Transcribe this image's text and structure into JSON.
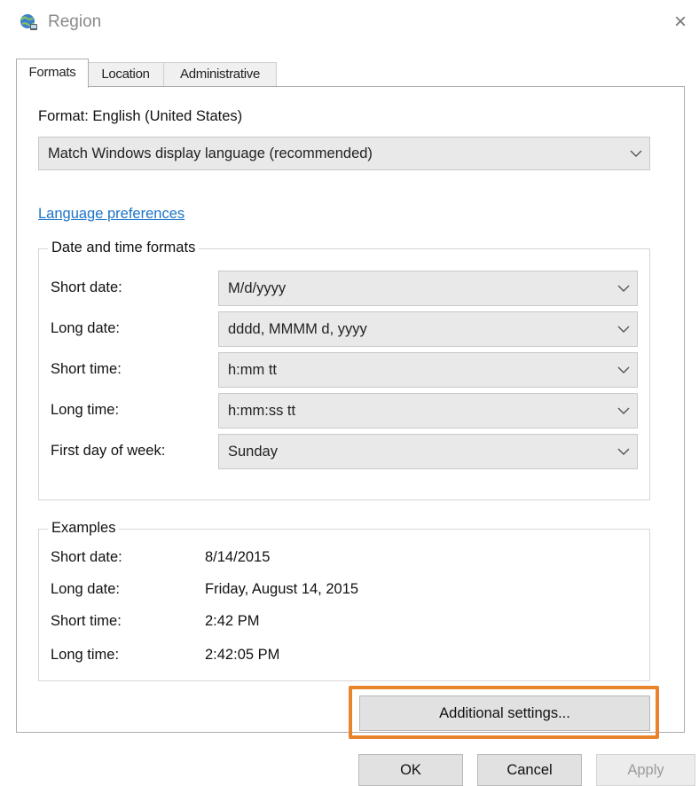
{
  "window": {
    "title": "Region",
    "icon": "globe-network-icon",
    "close_glyph": "×"
  },
  "tabs": [
    {
      "label": "Formats",
      "active": true
    },
    {
      "label": "Location",
      "active": false
    },
    {
      "label": "Administrative",
      "active": false
    }
  ],
  "formats": {
    "format_label": "Format: English (United States)",
    "format_value": "Match Windows display language (recommended)",
    "language_link": "Language preferences"
  },
  "date_time": {
    "group_title": "Date and time formats",
    "rows": [
      {
        "label": "Short date:",
        "value": "M/d/yyyy"
      },
      {
        "label": "Long date:",
        "value": "dddd, MMMM d, yyyy"
      },
      {
        "label": "Short time:",
        "value": "h:mm tt"
      },
      {
        "label": "Long time:",
        "value": "h:mm:ss tt"
      },
      {
        "label": "First day of week:",
        "value": "Sunday"
      }
    ]
  },
  "examples": {
    "group_title": "Examples",
    "rows": [
      {
        "label": "Short date:",
        "value": "8/14/2015"
      },
      {
        "label": "Long date:",
        "value": "Friday, August 14, 2015"
      },
      {
        "label": "Short time:",
        "value": "2:42 PM"
      },
      {
        "label": "Long time:",
        "value": "2:42:05 PM"
      }
    ]
  },
  "buttons": {
    "additional": "Additional settings...",
    "ok": "OK",
    "cancel": "Cancel",
    "apply": "Apply"
  },
  "colors": {
    "highlight": "#e8852c",
    "link": "#1a73c9"
  }
}
